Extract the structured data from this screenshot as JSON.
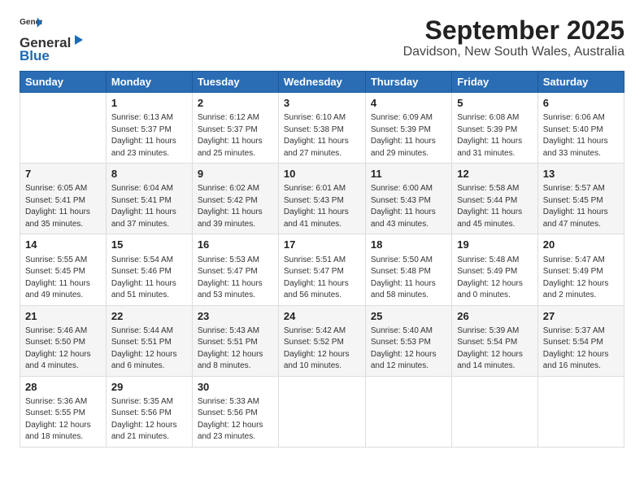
{
  "header": {
    "logo_general": "General",
    "logo_blue": "Blue",
    "month": "September 2025",
    "location": "Davidson, New South Wales, Australia"
  },
  "days_of_week": [
    "Sunday",
    "Monday",
    "Tuesday",
    "Wednesday",
    "Thursday",
    "Friday",
    "Saturday"
  ],
  "weeks": [
    [
      {
        "day": "",
        "info": ""
      },
      {
        "day": "1",
        "info": "Sunrise: 6:13 AM\nSunset: 5:37 PM\nDaylight: 11 hours\nand 23 minutes."
      },
      {
        "day": "2",
        "info": "Sunrise: 6:12 AM\nSunset: 5:37 PM\nDaylight: 11 hours\nand 25 minutes."
      },
      {
        "day": "3",
        "info": "Sunrise: 6:10 AM\nSunset: 5:38 PM\nDaylight: 11 hours\nand 27 minutes."
      },
      {
        "day": "4",
        "info": "Sunrise: 6:09 AM\nSunset: 5:39 PM\nDaylight: 11 hours\nand 29 minutes."
      },
      {
        "day": "5",
        "info": "Sunrise: 6:08 AM\nSunset: 5:39 PM\nDaylight: 11 hours\nand 31 minutes."
      },
      {
        "day": "6",
        "info": "Sunrise: 6:06 AM\nSunset: 5:40 PM\nDaylight: 11 hours\nand 33 minutes."
      }
    ],
    [
      {
        "day": "7",
        "info": "Sunrise: 6:05 AM\nSunset: 5:41 PM\nDaylight: 11 hours\nand 35 minutes."
      },
      {
        "day": "8",
        "info": "Sunrise: 6:04 AM\nSunset: 5:41 PM\nDaylight: 11 hours\nand 37 minutes."
      },
      {
        "day": "9",
        "info": "Sunrise: 6:02 AM\nSunset: 5:42 PM\nDaylight: 11 hours\nand 39 minutes."
      },
      {
        "day": "10",
        "info": "Sunrise: 6:01 AM\nSunset: 5:43 PM\nDaylight: 11 hours\nand 41 minutes."
      },
      {
        "day": "11",
        "info": "Sunrise: 6:00 AM\nSunset: 5:43 PM\nDaylight: 11 hours\nand 43 minutes."
      },
      {
        "day": "12",
        "info": "Sunrise: 5:58 AM\nSunset: 5:44 PM\nDaylight: 11 hours\nand 45 minutes."
      },
      {
        "day": "13",
        "info": "Sunrise: 5:57 AM\nSunset: 5:45 PM\nDaylight: 11 hours\nand 47 minutes."
      }
    ],
    [
      {
        "day": "14",
        "info": "Sunrise: 5:55 AM\nSunset: 5:45 PM\nDaylight: 11 hours\nand 49 minutes."
      },
      {
        "day": "15",
        "info": "Sunrise: 5:54 AM\nSunset: 5:46 PM\nDaylight: 11 hours\nand 51 minutes."
      },
      {
        "day": "16",
        "info": "Sunrise: 5:53 AM\nSunset: 5:47 PM\nDaylight: 11 hours\nand 53 minutes."
      },
      {
        "day": "17",
        "info": "Sunrise: 5:51 AM\nSunset: 5:47 PM\nDaylight: 11 hours\nand 56 minutes."
      },
      {
        "day": "18",
        "info": "Sunrise: 5:50 AM\nSunset: 5:48 PM\nDaylight: 11 hours\nand 58 minutes."
      },
      {
        "day": "19",
        "info": "Sunrise: 5:48 AM\nSunset: 5:49 PM\nDaylight: 12 hours\nand 0 minutes."
      },
      {
        "day": "20",
        "info": "Sunrise: 5:47 AM\nSunset: 5:49 PM\nDaylight: 12 hours\nand 2 minutes."
      }
    ],
    [
      {
        "day": "21",
        "info": "Sunrise: 5:46 AM\nSunset: 5:50 PM\nDaylight: 12 hours\nand 4 minutes."
      },
      {
        "day": "22",
        "info": "Sunrise: 5:44 AM\nSunset: 5:51 PM\nDaylight: 12 hours\nand 6 minutes."
      },
      {
        "day": "23",
        "info": "Sunrise: 5:43 AM\nSunset: 5:51 PM\nDaylight: 12 hours\nand 8 minutes."
      },
      {
        "day": "24",
        "info": "Sunrise: 5:42 AM\nSunset: 5:52 PM\nDaylight: 12 hours\nand 10 minutes."
      },
      {
        "day": "25",
        "info": "Sunrise: 5:40 AM\nSunset: 5:53 PM\nDaylight: 12 hours\nand 12 minutes."
      },
      {
        "day": "26",
        "info": "Sunrise: 5:39 AM\nSunset: 5:54 PM\nDaylight: 12 hours\nand 14 minutes."
      },
      {
        "day": "27",
        "info": "Sunrise: 5:37 AM\nSunset: 5:54 PM\nDaylight: 12 hours\nand 16 minutes."
      }
    ],
    [
      {
        "day": "28",
        "info": "Sunrise: 5:36 AM\nSunset: 5:55 PM\nDaylight: 12 hours\nand 18 minutes."
      },
      {
        "day": "29",
        "info": "Sunrise: 5:35 AM\nSunset: 5:56 PM\nDaylight: 12 hours\nand 21 minutes."
      },
      {
        "day": "30",
        "info": "Sunrise: 5:33 AM\nSunset: 5:56 PM\nDaylight: 12 hours\nand 23 minutes."
      },
      {
        "day": "",
        "info": ""
      },
      {
        "day": "",
        "info": ""
      },
      {
        "day": "",
        "info": ""
      },
      {
        "day": "",
        "info": ""
      }
    ]
  ]
}
